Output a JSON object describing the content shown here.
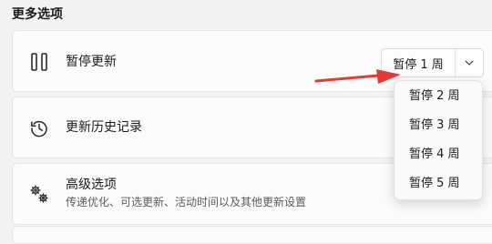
{
  "section": {
    "title": "更多选项"
  },
  "pause_updates": {
    "label": "暂停更新",
    "split_button_label": "暂停 1 周",
    "options": [
      "暂停 2 周",
      "暂停 3 周",
      "暂停 4 周",
      "暂停 5 周"
    ]
  },
  "history": {
    "label": "更新历史记录"
  },
  "advanced": {
    "label": "高级选项",
    "description": "传递优化、可选更新、活动时间以及其他更新设置"
  },
  "icons": {
    "pause": "pause-icon",
    "history": "history-icon",
    "advanced": "gears-icon",
    "dropdown": "chevron-down-icon",
    "annotation": "red-arrow-icon"
  },
  "colors": {
    "annotation_arrow": "#e53935"
  }
}
